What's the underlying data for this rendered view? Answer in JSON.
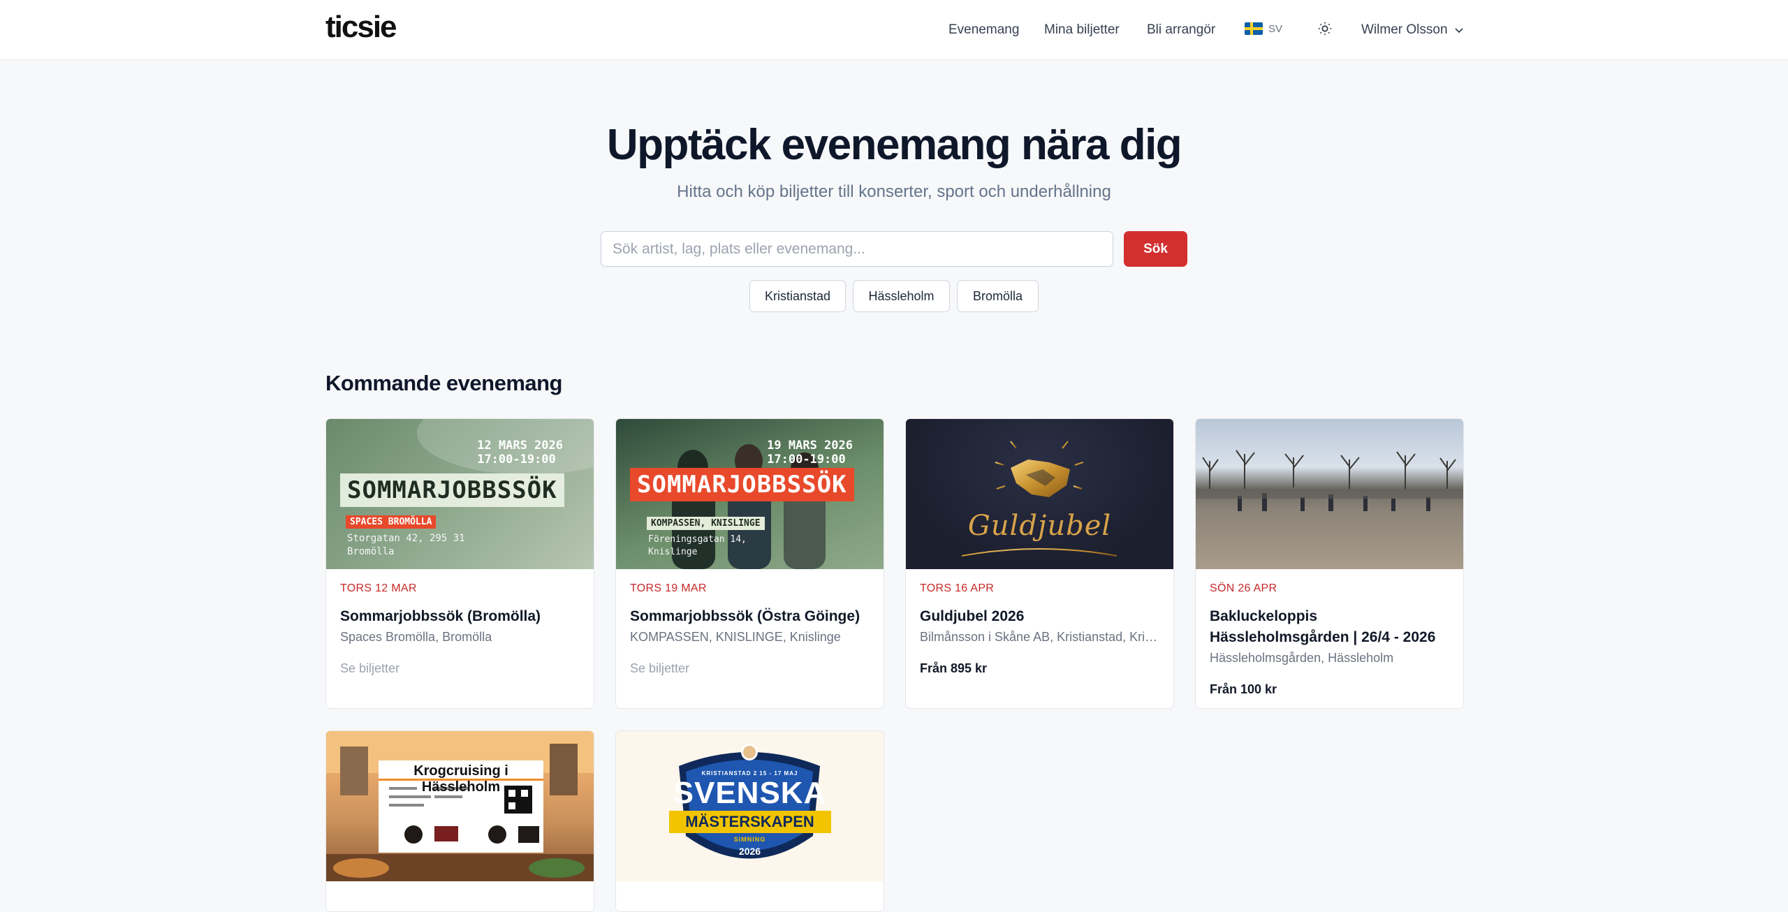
{
  "brand": {
    "logo": "ticsie"
  },
  "nav": {
    "events": "Evenemang",
    "tickets": "Mina biljetter",
    "organizer": "Bli arrangör",
    "lang": "SV",
    "user": "Wilmer Olsson"
  },
  "hero": {
    "title": "Upptäck evenemang nära dig",
    "subtitle": "Hitta och köp biljetter till konserter, sport och underhållning",
    "search_placeholder": "Sök artist, lag, plats eller evenemang...",
    "search_button": "Sök",
    "chips": [
      "Kristianstad",
      "Hässleholm",
      "Bromölla"
    ]
  },
  "section": {
    "title": "Kommande evenemang"
  },
  "events": [
    {
      "date": "TORS 12 MAR",
      "title": "Sommarjobbssök (Bromölla)",
      "venue": "Spaces Bromölla, Bromölla",
      "link": "Se biljetter",
      "poster": {
        "date_line1": "12 MARS 2026",
        "date_line2": "17:00-19:00",
        "headline": "SOMMARJOBBSSÖK",
        "tag": "SPACES BROMÖLLA",
        "addr1": "Storgatan 42, 295 31",
        "addr2": "Bromölla"
      }
    },
    {
      "date": "TORS 19 MAR",
      "title": "Sommarjobbssök (Östra Göinge)",
      "venue": "KOMPASSEN, KNISLINGE, Knislinge",
      "link": "Se biljetter",
      "poster": {
        "date_line1": "19 MARS 2026",
        "date_line2": "17:00-19:00",
        "headline": "SOMMARJOBBSSÖK",
        "tag": "KOMPASSEN, KNISLINGE",
        "addr1": "Föreningsgatan 14,",
        "addr2": "Knislinge"
      }
    },
    {
      "date": "TORS 16 APR",
      "title": "Guldjubel 2026",
      "venue": "Bilmånsson i Skåne AB, Kristianstad, Kristianstad",
      "price": "Från 895 kr",
      "poster": {
        "script": "Guldjubel"
      }
    },
    {
      "date": "SÖN 26 APR",
      "title": "Bakluckeloppis Hässleholmsgården | 26/4 - 2026",
      "venue": "Hässleholmsgården, Hässleholm",
      "price": "Från 100 kr"
    },
    {
      "poster": {
        "headline": "Krogcruising i Hässleholm"
      }
    },
    {
      "poster": {
        "top": "KRISTIANSTAD 2 15 - 17 MAJ",
        "headline": "SVENSKA",
        "banner": "MÄSTERSKAPEN",
        "sub": "SIMNING",
        "year": "2026"
      }
    }
  ],
  "colors": {
    "accent": "#d32f2f",
    "date": "#c62828",
    "text": "#0f172a",
    "muted": "#6b7280"
  }
}
